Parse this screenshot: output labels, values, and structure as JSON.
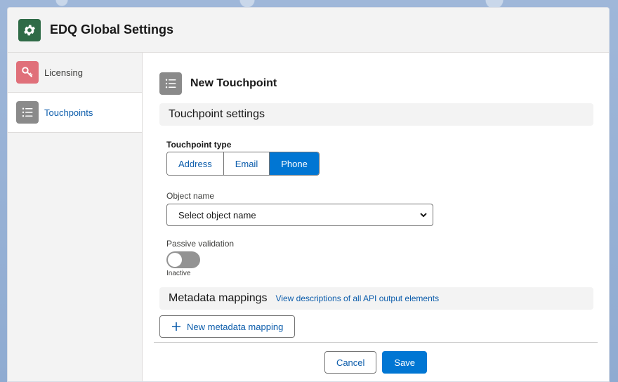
{
  "header": {
    "title": "EDQ Global Settings",
    "icon": "gear-icon",
    "icon_color": "#2f6b47"
  },
  "sidebar": {
    "items": [
      {
        "label": "Licensing",
        "icon": "key-icon",
        "icon_color": "#e0707a",
        "active": false
      },
      {
        "label": "Touchpoints",
        "icon": "list-icon",
        "icon_color": "#8a8a8a",
        "active": true
      }
    ]
  },
  "main": {
    "title": "New Touchpoint",
    "settings_section": "Touchpoint settings",
    "touchpoint_type": {
      "label": "Touchpoint type",
      "options": [
        "Address",
        "Email",
        "Phone"
      ],
      "selected": "Phone"
    },
    "object_name": {
      "label": "Object name",
      "value": "Select object name"
    },
    "passive_validation": {
      "label": "Passive validation",
      "state": "Inactive"
    },
    "metadata": {
      "title": "Metadata mappings",
      "link": "View descriptions of all API output elements",
      "new_button": "New metadata mapping"
    }
  },
  "footer": {
    "cancel_label": "Cancel",
    "save_label": "Save"
  },
  "colors": {
    "brand": "#0176d3",
    "link": "#0b5cab"
  }
}
